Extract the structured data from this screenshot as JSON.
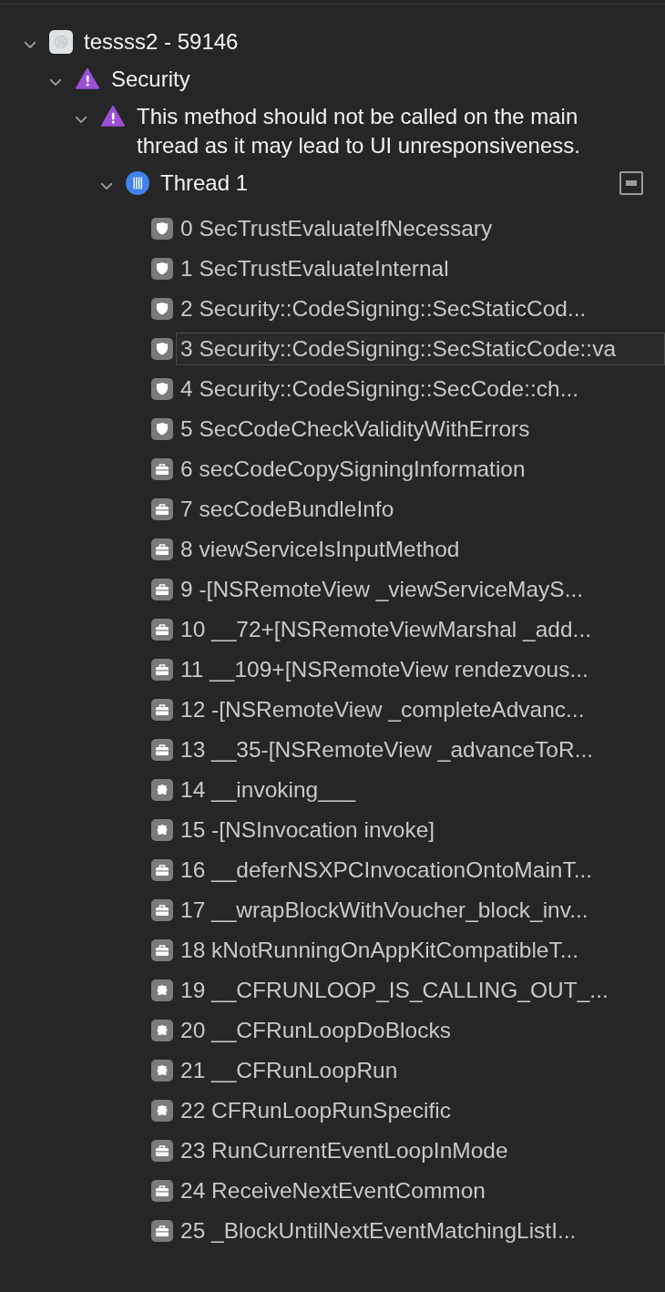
{
  "tree": [
    {
      "kind": "process",
      "title": "tessss2 - 59146",
      "expanded": true,
      "children": [
        {
          "kind": "category",
          "title": "Security",
          "expanded": true,
          "children": [
            {
              "kind": "issue",
              "title": "This method should not be called on the main thread as it may lead to UI unresponsiveness.",
              "expanded": true,
              "children": [
                {
                  "kind": "thread",
                  "title": "Thread 1",
                  "expanded": true,
                  "frames": [
                    {
                      "kind": "security",
                      "text": "0 SecTrustEvaluateIfNecessary",
                      "hovered": false
                    },
                    {
                      "kind": "security",
                      "text": "1 SecTrustEvaluateInternal",
                      "hovered": false
                    },
                    {
                      "kind": "security",
                      "text": "2 Security::CodeSigning::SecStaticCod...",
                      "hovered": false
                    },
                    {
                      "kind": "security",
                      "text": "3 Security::CodeSigning::SecStaticCode::va",
                      "hovered": true
                    },
                    {
                      "kind": "security",
                      "text": "4 Security::CodeSigning::SecCode::ch...",
                      "hovered": false
                    },
                    {
                      "kind": "security",
                      "text": "5 SecCodeCheckValidityWithErrors",
                      "hovered": false
                    },
                    {
                      "kind": "appkit",
                      "text": "6 secCodeCopySigningInformation",
                      "hovered": false
                    },
                    {
                      "kind": "appkit",
                      "text": "7 secCodeBundleInfo",
                      "hovered": false
                    },
                    {
                      "kind": "appkit",
                      "text": "8 viewServiceIsInputMethod",
                      "hovered": false
                    },
                    {
                      "kind": "appkit",
                      "text": "9 -[NSRemoteView _viewServiceMayS...",
                      "hovered": false
                    },
                    {
                      "kind": "appkit",
                      "text": "10 __72+[NSRemoteViewMarshal _add...",
                      "hovered": false
                    },
                    {
                      "kind": "appkit",
                      "text": "11 __109+[NSRemoteView rendezvous...",
                      "hovered": false
                    },
                    {
                      "kind": "appkit",
                      "text": "12 -[NSRemoteView _completeAdvanc...",
                      "hovered": false
                    },
                    {
                      "kind": "appkit",
                      "text": "13 __35-[NSRemoteView _advanceToR...",
                      "hovered": false
                    },
                    {
                      "kind": "foundation",
                      "text": "14 __invoking___",
                      "hovered": false
                    },
                    {
                      "kind": "foundation",
                      "text": "15 -[NSInvocation invoke]",
                      "hovered": false
                    },
                    {
                      "kind": "appkit",
                      "text": "16 __deferNSXPCInvocationOntoMainT...",
                      "hovered": false
                    },
                    {
                      "kind": "appkit",
                      "text": "17 __wrapBlockWithVoucher_block_inv...",
                      "hovered": false
                    },
                    {
                      "kind": "appkit",
                      "text": "18 kNotRunningOnAppKitCompatibleT...",
                      "hovered": false
                    },
                    {
                      "kind": "foundation",
                      "text": "19 __CFRUNLOOP_IS_CALLING_OUT_...",
                      "hovered": false
                    },
                    {
                      "kind": "foundation",
                      "text": "20 __CFRunLoopDoBlocks",
                      "hovered": false
                    },
                    {
                      "kind": "foundation",
                      "text": "21 __CFRunLoopRun",
                      "hovered": false
                    },
                    {
                      "kind": "foundation",
                      "text": "22 CFRunLoopRunSpecific",
                      "hovered": false
                    },
                    {
                      "kind": "appkit",
                      "text": "23 RunCurrentEventLoopInMode",
                      "hovered": false
                    },
                    {
                      "kind": "appkit",
                      "text": "24 ReceiveNextEventCommon",
                      "hovered": false
                    },
                    {
                      "kind": "appkit",
                      "text": "25 _BlockUntilNextEventMatchingListI...",
                      "hovered": false
                    }
                  ]
                }
              ]
            }
          ]
        }
      ]
    }
  ]
}
